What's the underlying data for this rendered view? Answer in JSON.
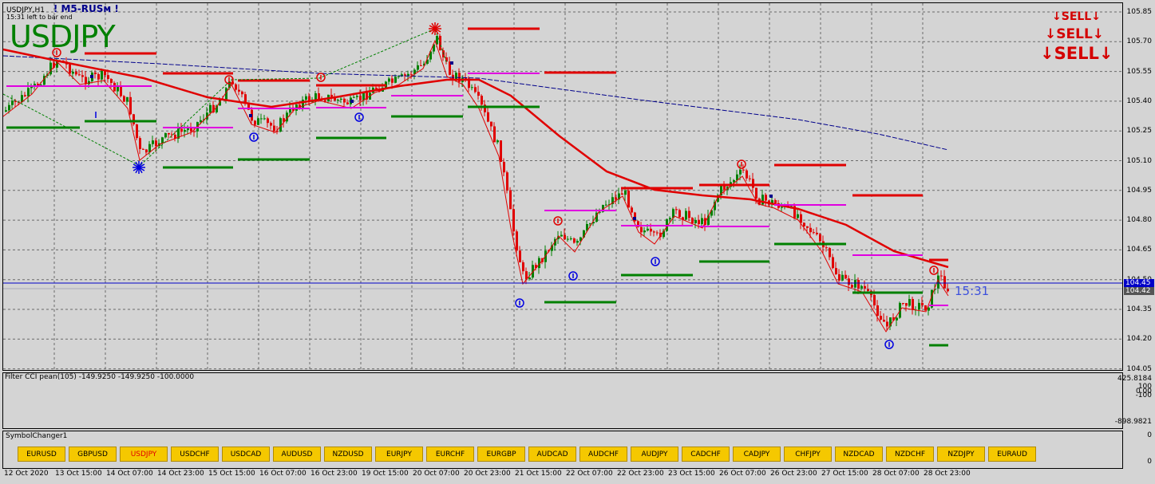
{
  "header": {
    "title": "USDJPY,H1",
    "indicator": "! M5-RUSм !",
    "bar_timer": "15:31 left to bar end",
    "symbol_big": "USDJPY",
    "timer_right": "15:31"
  },
  "sell_panel": {
    "lines": [
      "SELL",
      "SELL",
      "SELL"
    ],
    "color": "#d40000"
  },
  "price_axis": {
    "ticks": [
      "105.85",
      "105.70",
      "105.55",
      "105.40",
      "105.25",
      "105.10",
      "104.95",
      "104.80",
      "104.65",
      "104.50",
      "104.35",
      "104.20",
      "104.05"
    ],
    "bid_tag": "104.45",
    "ask_tag": "104.42"
  },
  "cci": {
    "label": "Filter CCI pean(105) -149.9250 -149.9250 -100.0000",
    "axis": [
      "425.8184",
      "100",
      "0.00",
      "-100",
      "-898.9821"
    ]
  },
  "symbol_changer": {
    "label": "SymbolChanger1",
    "active": "USDJPY",
    "symbols": [
      "EURUSD",
      "GBPUSD",
      "USDJPY",
      "USDCHF",
      "USDCAD",
      "AUDUSD",
      "NZDUSD",
      "EURJPY",
      "EURCHF",
      "EURGBP",
      "AUDCAD",
      "AUDCHF",
      "AUDJPY",
      "CADCHF",
      "CADJPY",
      "CHFJPY",
      "NZDCAD",
      "NZDCHF",
      "NZDJPY",
      "EURAUD"
    ],
    "axis": [
      "0",
      "0"
    ]
  },
  "time_axis": [
    "12 Oct 2020",
    "13 Oct 15:00",
    "14 Oct 07:00",
    "14 Oct 23:00",
    "15 Oct 15:00",
    "16 Oct 07:00",
    "16 Oct 23:00",
    "19 Oct 15:00",
    "20 Oct 07:00",
    "20 Oct 23:00",
    "21 Oct 15:00",
    "22 Oct 07:00",
    "22 Oct 23:00",
    "23 Oct 15:00",
    "26 Oct 07:00",
    "26 Oct 23:00",
    "27 Oct 15:00",
    "28 Oct 07:00",
    "28 Oct 23:00"
  ],
  "colors": {
    "up_candle": "#008000",
    "down_candle": "#e00000",
    "ma_fast": "#e00000",
    "ma_slow": "#00008b",
    "support": "#008000",
    "resistance": "#e00000",
    "mid": "#e000e0",
    "bid_line": "#0000c8"
  }
}
